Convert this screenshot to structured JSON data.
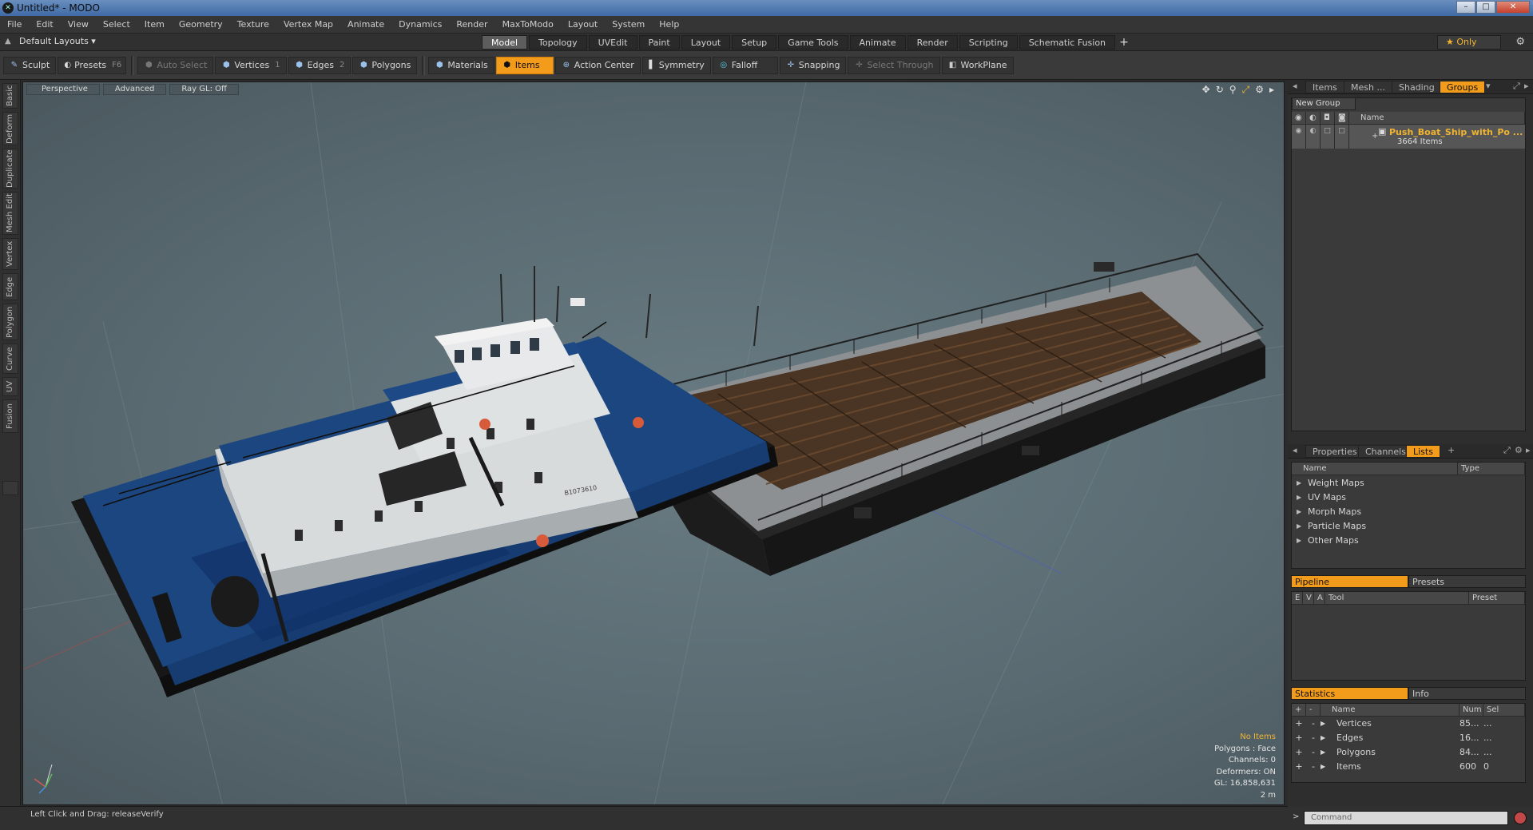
{
  "window": {
    "title": "Untitled* - MODO",
    "app_icon": "modo-icon"
  },
  "menu": [
    "File",
    "Edit",
    "View",
    "Select",
    "Item",
    "Geometry",
    "Texture",
    "Vertex Map",
    "Animate",
    "Dynamics",
    "Render",
    "MaxToModo",
    "Layout",
    "System",
    "Help"
  ],
  "layout": {
    "selector": "Default Layouts ▾"
  },
  "tabs": [
    "Model",
    "Topology",
    "UVEdit",
    "Paint",
    "Layout",
    "Setup",
    "Game Tools",
    "Animate",
    "Render",
    "Scripting",
    "Schematic Fusion"
  ],
  "active_tab": "Model",
  "only_label": "★  Only",
  "toolbar": {
    "sculpt": "Sculpt",
    "presets": "Presets",
    "presets_key": "F6",
    "auto_select": "Auto Select",
    "vertices": "Vertices",
    "vertices_key": "1",
    "edges": "Edges",
    "edges_key": "2",
    "polygons": "Polygons",
    "materials": "Materials",
    "items": "Items",
    "action_center": "Action Center",
    "symmetry": "Symmetry",
    "falloff": "Falloff",
    "snapping": "Snapping",
    "select_through": "Select Through",
    "workplane": "WorkPlane"
  },
  "left_tabs": [
    "Basic",
    "Deform",
    "Duplicate",
    "Mesh Edit",
    "Vertex",
    "Edge",
    "Polygon",
    "Curve",
    "UV",
    "Fusion"
  ],
  "viewport": {
    "view": "Perspective",
    "advanced": "Advanced",
    "raygl": "Ray GL: Off",
    "info": {
      "no_items": "No Items",
      "polygons": "Polygons : Face",
      "channels": "Channels: 0",
      "deformers": "Deformers: ON",
      "gl": "GL: 16,858,631",
      "scale": "2 m"
    },
    "hull_label": "B1073610"
  },
  "right_top_tabs": [
    "Items",
    "Mesh ...",
    "Shading",
    "Groups"
  ],
  "groups": {
    "new_group": "New Group",
    "name_header": "Name",
    "item_name": "Push_Boat_Ship_with_Po ...",
    "item_count": "3664 Items"
  },
  "right_mid_tabs": [
    "Properties",
    "Channels",
    "Lists"
  ],
  "lists": {
    "name_header": "Name",
    "type_header": "Type",
    "items": [
      "Weight Maps",
      "UV Maps",
      "Morph Maps",
      "Particle Maps",
      "Other Maps"
    ]
  },
  "pipeline": {
    "tab": "Pipeline",
    "presets_tab": "Presets",
    "headers": {
      "e": "E",
      "v": "V",
      "a": "A",
      "tool": "Tool",
      "preset": "Preset"
    }
  },
  "statistics": {
    "tab": "Statistics",
    "info_tab": "Info",
    "headers": {
      "plus": "+",
      "minus": "-",
      "name": "Name",
      "num": "Num",
      "sel": "Sel"
    },
    "rows": [
      {
        "name": "Vertices",
        "num": "85...",
        "sel": "..."
      },
      {
        "name": "Edges",
        "num": "16...",
        "sel": "..."
      },
      {
        "name": "Polygons",
        "num": "84...",
        "sel": "..."
      },
      {
        "name": "Items",
        "num": "600",
        "sel": "0"
      }
    ]
  },
  "status": {
    "text": "Left Click and Drag:   releaseVerify"
  },
  "command": {
    "placeholder": "Command"
  },
  "colors": {
    "accent": "#f39c1b",
    "hull_blue": "#1f4f95",
    "viewport": "#5f7178"
  }
}
